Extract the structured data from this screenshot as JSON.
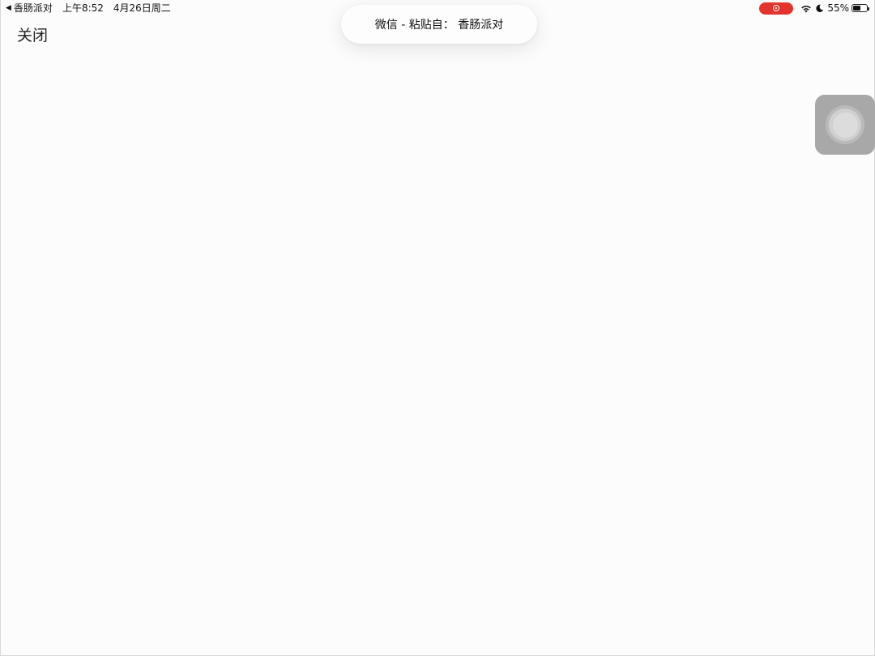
{
  "status_bar": {
    "back_arrow": "◀",
    "back_app": "香肠派对",
    "time": "上午8:52",
    "date": "4月26日周二",
    "battery_percent": "55%",
    "battery_level": 0.55,
    "recording_color": "#e2342c",
    "icons": [
      "screen-recording-icon",
      "wifi-icon",
      "do-not-disturb-moon-icon",
      "battery-icon"
    ]
  },
  "paste_banner": {
    "text": "微信 - 粘贴自： 香肠派对"
  },
  "close_button": {
    "label": "关闭"
  },
  "assistive_touch": {
    "icon": "assistive-touch-icon"
  }
}
